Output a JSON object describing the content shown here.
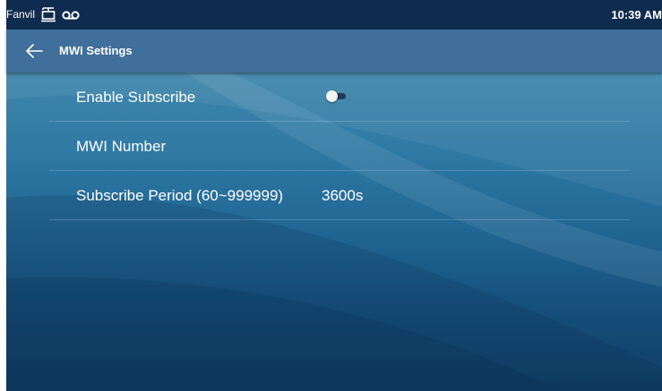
{
  "status_bar": {
    "carrier": "Fanvil",
    "network_icon": "network-icon",
    "voicemail_icon": "voicemail-icon",
    "time": "10:39 AM"
  },
  "app_bar": {
    "back_icon": "arrow-left-icon",
    "title": "MWI Settings"
  },
  "settings": [
    {
      "label": "Enable Subscribe",
      "control": "toggle",
      "enabled": false
    },
    {
      "label": "MWI Number",
      "value": ""
    },
    {
      "label": "Subscribe Period (60~999999)",
      "value": "3600s"
    }
  ],
  "colors": {
    "status_bar": "#0f2b4e",
    "app_bar": "#3f6f9a",
    "background_top": "#3f86ab",
    "background_bottom": "#103d63",
    "toggle_thumb": "#f2f2f2",
    "toggle_track": "#1c3a5c"
  }
}
